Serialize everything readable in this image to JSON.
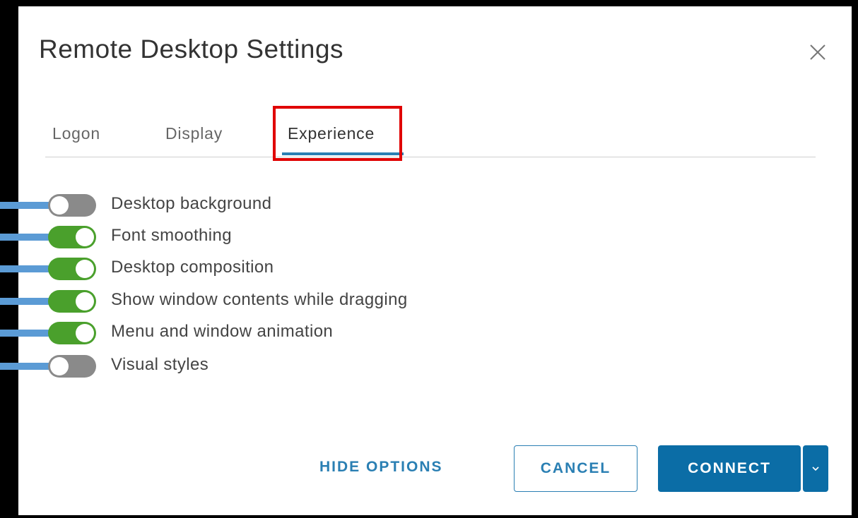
{
  "dialog": {
    "title": "Remote Desktop Settings",
    "close_icon": "close-icon"
  },
  "tabs": [
    {
      "label": "Logon",
      "selected": false
    },
    {
      "label": "Display",
      "selected": false
    },
    {
      "label": "Experience",
      "selected": true
    }
  ],
  "options": [
    {
      "label": "Desktop background",
      "enabled": false
    },
    {
      "label": "Font smoothing",
      "enabled": true
    },
    {
      "label": "Desktop composition",
      "enabled": true
    },
    {
      "label": "Show window contents while dragging",
      "enabled": true
    },
    {
      "label": "Menu and window animation",
      "enabled": true
    },
    {
      "label": "Visual styles",
      "enabled": false
    }
  ],
  "footer": {
    "hide_options_label": "HIDE OPTIONS",
    "cancel_label": "CANCEL",
    "connect_label": "CONNECT",
    "dropdown_icon": "chevron-down-icon"
  },
  "colors": {
    "accent": "#0b6da6",
    "toggle_on": "#4aa02c",
    "toggle_off": "#8a8a8a",
    "highlight": "#e00000",
    "connector": "#5b9bd5"
  }
}
